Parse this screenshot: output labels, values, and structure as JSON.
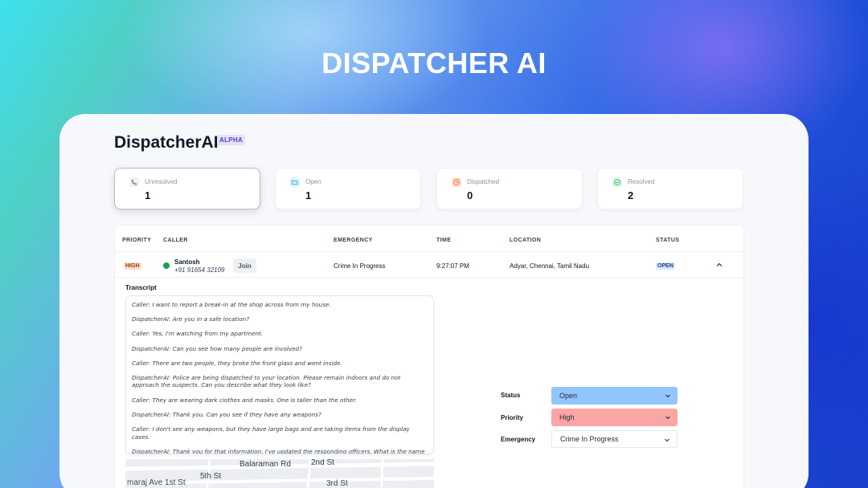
{
  "hero": {
    "title": "DISPATCHER AI"
  },
  "app": {
    "name": "DispatcherAI",
    "badge": "ALPHA"
  },
  "stats": [
    {
      "label": "Unresolved",
      "value": "1",
      "icon": "phone-icon",
      "color": "#6b7280"
    },
    {
      "label": "Open",
      "value": "1",
      "icon": "folder-open-icon",
      "color": "#0ea5e9"
    },
    {
      "label": "Dispatched",
      "value": "0",
      "icon": "clock-icon",
      "color": "#ea580c"
    },
    {
      "label": "Resolved",
      "value": "2",
      "icon": "check-badge-icon",
      "color": "#16a34a"
    }
  ],
  "table": {
    "headers": {
      "priority": "PRIORITY",
      "caller": "CALLER",
      "emergency": "EMERGENCY",
      "time": "TIME",
      "location": "LOCATION",
      "status": "STATUS"
    },
    "row": {
      "priority": "HIGH",
      "caller_name": "Santosh",
      "caller_phone": "+91 91654 32109",
      "join_label": "Join",
      "emergency": "Crime In Progress",
      "time": "9:27:07 PM",
      "location": "Adyar, Chennai, Tamil Nadu",
      "status": "OPEN"
    }
  },
  "transcript": {
    "label": "Transcript",
    "lines": [
      "Caller: I want to report a break-in at the shop across from my house.",
      "DispatcherAI: Are you in a safe location?",
      "Caller: Yes, I'm watching from my apartment.",
      "DispatcherAI: Can you see how many people are involved?",
      "Caller: There are two people, they broke the front glass and went inside.",
      "DispatcherAI: Police are being dispatched to your location. Please remain indoors and do not approach the suspects. Can you describe what they look like?",
      "Caller: They are wearing dark clothes and masks. One is taller than the other.",
      "DispatcherAI: Thank you. Can you see if they have any weapons?",
      "Caller: I don't see any weapons, but they have large bags and are taking items from the display cases.",
      "DispatcherAI: Thank you for that information. I've updated the responding officers. What is the name o"
    ]
  },
  "map": {
    "labels": [
      "Balaraman Rd",
      "2nd St",
      "5th St",
      "maraj Ave 1st St",
      "3rd St"
    ]
  },
  "form": {
    "status": {
      "label": "Status",
      "value": "Open",
      "color": "#93c5fd"
    },
    "priority": {
      "label": "Priority",
      "value": "High",
      "color": "#fca5a5"
    },
    "emergency": {
      "label": "Emergency",
      "value": "Crime In Progress",
      "color": "#ffffff"
    }
  }
}
